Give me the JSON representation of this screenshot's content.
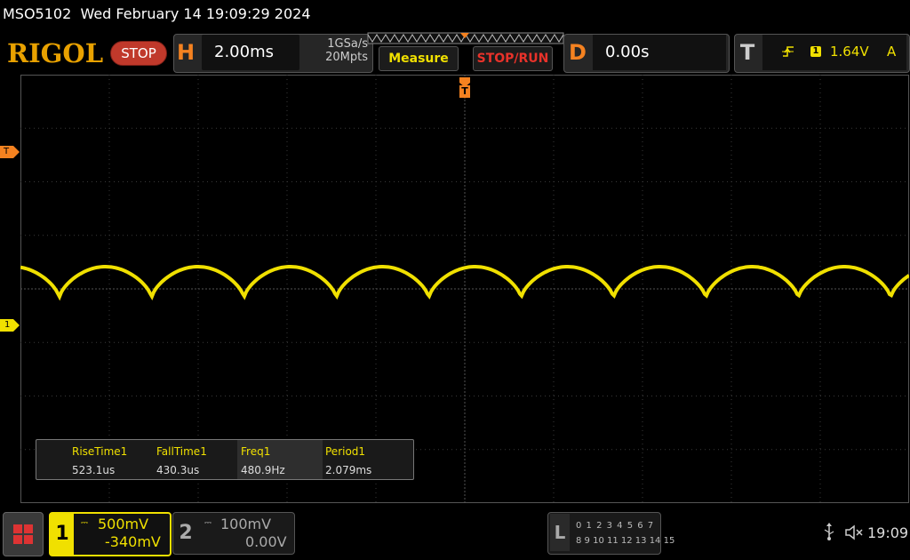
{
  "status": {
    "model": "MSO5102",
    "datetime": "Wed February 14 19:09:29 2024"
  },
  "brand": {
    "logo": "RIGOL",
    "run_state": "STOP"
  },
  "horizontal": {
    "letter": "H",
    "timebase": "2.00ms",
    "sample_rate": "1GSa/s",
    "memory_depth": "20Mpts"
  },
  "buttons": {
    "measure": "Measure",
    "stop_run": "STOP/RUN"
  },
  "delay": {
    "letter": "D",
    "value": "0.00s"
  },
  "trigger": {
    "letter": "T",
    "edge_icon": "rising-edge-icon",
    "source": "1",
    "level": "1.64V",
    "mode": "A"
  },
  "markers": {
    "trigger_level_label": "T",
    "channel1_label": "1",
    "trigger_pos_label": "T"
  },
  "measurements": [
    {
      "label": "RiseTime1",
      "value": "523.1us"
    },
    {
      "label": "FallTime1",
      "value": "430.3us"
    },
    {
      "label": "Freq1",
      "value": "480.9Hz"
    },
    {
      "label": "Period1",
      "value": "2.079ms"
    }
  ],
  "channels": [
    {
      "num": "1",
      "coupling_icon": "dc-coupling-icon",
      "scale": "500mV",
      "offset": "-340mV",
      "active": true
    },
    {
      "num": "2",
      "coupling_icon": "dc-coupling-icon",
      "scale": "100mV",
      "offset": "0.00V",
      "active": false
    }
  ],
  "logic": {
    "letter": "L",
    "row1": "0 1 2 3  4 5 6 7",
    "row2": "8 9 10 11 12 13 14 15"
  },
  "system": {
    "usb_icon": "usb-icon",
    "speaker_icon": "speaker-muted-icon",
    "time": "19:09"
  },
  "colors": {
    "channel1": "#f0e000",
    "accent": "#f58220",
    "stop": "#c0392b",
    "grid": "#3a3a3a"
  },
  "waveform": {
    "frequency_hz": 480.9,
    "cycles_on_screen": 9.62
  }
}
